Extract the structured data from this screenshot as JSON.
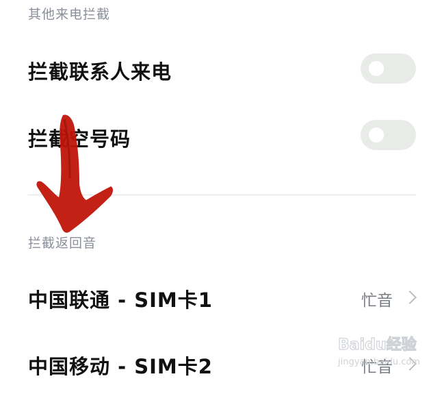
{
  "sections": {
    "other_call_block": {
      "header": "其他来电拦截",
      "items": [
        {
          "label": "拦截联系人来电",
          "toggle_on": false
        },
        {
          "label": "拦截空号码",
          "toggle_on": false
        }
      ]
    },
    "block_return_tone": {
      "header": "拦截返回音",
      "items": [
        {
          "label": "中国联通 - SIM卡1",
          "value": "忙音"
        },
        {
          "label": "中国移动 - SIM卡2",
          "value": "忙音"
        }
      ]
    }
  },
  "overlays": {
    "annotation_arrow_color": "#c0140a",
    "watermark": {
      "brand": "Baidu经验",
      "domain": "jingyan.baidu.com"
    }
  },
  "colors": {
    "header_text": "#8a8f99",
    "toggle_off_track": "#e9ebe9",
    "value_text": "#777b82"
  }
}
